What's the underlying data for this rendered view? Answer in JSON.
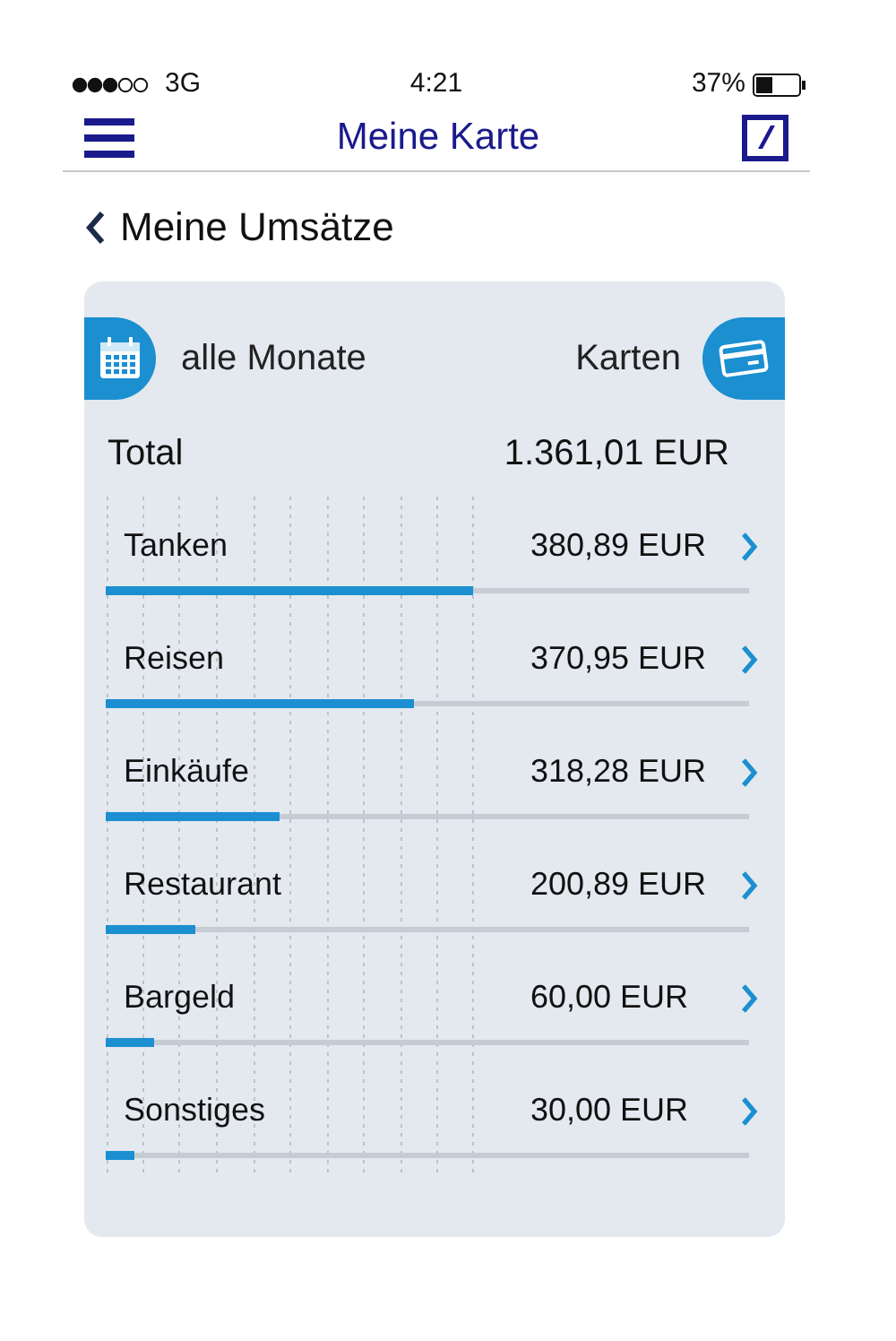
{
  "status_bar": {
    "carrier": "3G",
    "time": "4:21",
    "battery": "37%"
  },
  "nav": {
    "title": "Meine Karte"
  },
  "back": {
    "label": "Meine Umsätze"
  },
  "filters": {
    "months": "alle Monate",
    "cards": "Karten"
  },
  "total": {
    "label": "Total",
    "amount": "1.361,01 EUR"
  },
  "categories": [
    {
      "name": "Tanken",
      "amount": "380,89 EUR",
      "level": 0.57
    },
    {
      "name": "Reisen",
      "amount": "370,95 EUR",
      "level": 0.48
    },
    {
      "name": "Einkäufe",
      "amount": "318,28 EUR",
      "level": 0.27
    },
    {
      "name": "Restaurant",
      "amount": "200,89 EUR",
      "level": 0.14
    },
    {
      "name": "Bargeld",
      "amount": "60,00 EUR",
      "level": 0.075
    },
    {
      "name": "Sonstiges",
      "amount": "30,00 EUR",
      "level": 0.045
    }
  ]
}
